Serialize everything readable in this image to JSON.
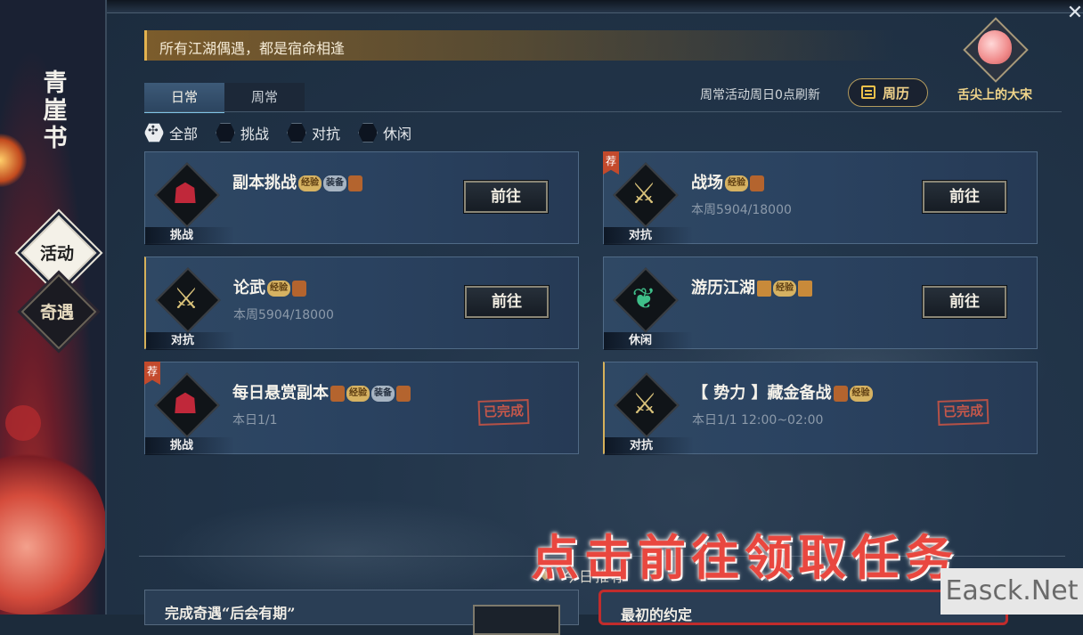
{
  "sidebar": {
    "title": "青崖书",
    "nav": [
      {
        "label": "活动",
        "active": true
      },
      {
        "label": "奇遇",
        "active": false
      }
    ]
  },
  "banner": {
    "text": "所有江湖偶遇，都是宿命相逢"
  },
  "corner_badge": {
    "label": "舌尖上的大宋"
  },
  "tabs": [
    {
      "label": "日常",
      "active": true
    },
    {
      "label": "周常",
      "active": false
    }
  ],
  "refresh_note": "周常活动周日0点刷新",
  "calendar_button": {
    "label": "周历"
  },
  "filters": [
    {
      "label": "全部",
      "selected": true
    },
    {
      "label": "挑战",
      "selected": false
    },
    {
      "label": "对抗",
      "selected": false
    },
    {
      "label": "休闲",
      "selected": false
    }
  ],
  "reward_labels": {
    "exp": "经验",
    "equip": "装备"
  },
  "go_label": "前往",
  "done_label": "已完成",
  "activities": [
    {
      "title": "副本挑战",
      "sub": "",
      "type": "挑战",
      "recommended": false,
      "status": "go",
      "rewards": [
        "exp",
        "equip",
        "item"
      ]
    },
    {
      "title": "战场",
      "sub": "本周5904/18000",
      "type": "对抗",
      "recommended": true,
      "status": "go",
      "rewards": [
        "exp",
        "item"
      ]
    },
    {
      "title": "论武",
      "sub": "本周5904/18000",
      "type": "对抗",
      "recommended": false,
      "status": "go",
      "rewards": [
        "exp",
        "item"
      ]
    },
    {
      "title": "游历江湖",
      "sub": "",
      "type": "休闲",
      "recommended": false,
      "status": "go",
      "rewards": [
        "book",
        "exp",
        "book"
      ]
    },
    {
      "title": "每日悬赏副本",
      "sub": "本日1/1",
      "type": "挑战",
      "recommended": true,
      "status": "done",
      "rewards": [
        "item",
        "exp",
        "equip",
        "item"
      ]
    },
    {
      "title": "【 势力 】藏金备战",
      "sub": "本日1/1   12:00~02:00",
      "type": "对抗",
      "recommended": false,
      "status": "done",
      "rewards": [
        "item",
        "exp"
      ]
    }
  ],
  "recommend_heading": "今日推荐",
  "bottom_cards": [
    {
      "text": "完成奇遇“后会有期”"
    },
    {
      "text": "最初的约定"
    }
  ],
  "overlay_caption": "点击前往领取任务",
  "watermark": "Easck.Net",
  "colors": {
    "accent_gold": "#d6b15a",
    "challenge_red": "#c0283a",
    "combat_gold": "#d9c27a",
    "leisure_green": "#3fbf8a"
  }
}
